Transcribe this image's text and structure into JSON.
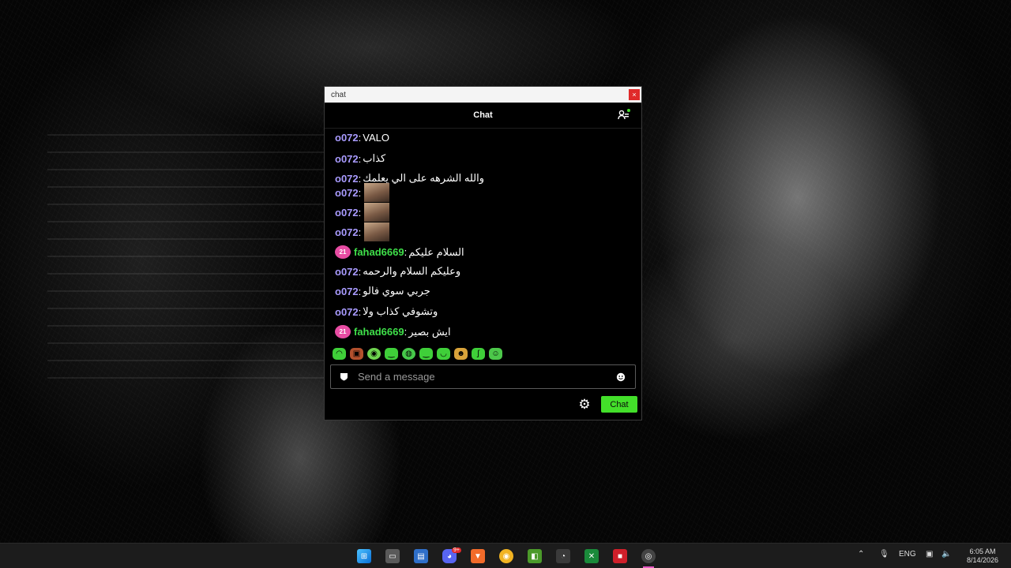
{
  "window": {
    "title": "chat",
    "close": "×"
  },
  "chat": {
    "title": "Chat",
    "messages": [
      {
        "user": "o072",
        "text": "VALO"
      },
      {
        "user": "o072",
        "text": "كذاب"
      },
      {
        "user": "o072",
        "text": "والله الشرهه على الي يعلمك"
      },
      {
        "user": "o072",
        "text": ""
      },
      {
        "user": "o072",
        "text": ""
      },
      {
        "user": "o072",
        "text": ""
      },
      {
        "user": "fahad6669",
        "badge": "21",
        "text": "السلام عليكم"
      },
      {
        "user": "o072",
        "text": "وعليكم السلام والرحمه"
      },
      {
        "user": "o072",
        "text": "جربي سوي فالو"
      },
      {
        "user": "o072",
        "text": "وتشوفي كذاب ولا"
      },
      {
        "user": "fahad6669",
        "badge": "21",
        "text": "ايش بصير"
      }
    ],
    "input_placeholder": "Send a message",
    "send_label": "Chat"
  },
  "colors": {
    "accent": "#43df2a",
    "user1": "#a99bff",
    "user2": "#3fe04a",
    "badge": "#e84ca3"
  },
  "icons": [
    "users-icon",
    "emoji-icon",
    "shield-icon",
    "gear-icon"
  ],
  "taskbar": {
    "time": "6:05 AM",
    "date": "8/14/2026",
    "lang": "ENG",
    "discord_badge": "9+"
  }
}
